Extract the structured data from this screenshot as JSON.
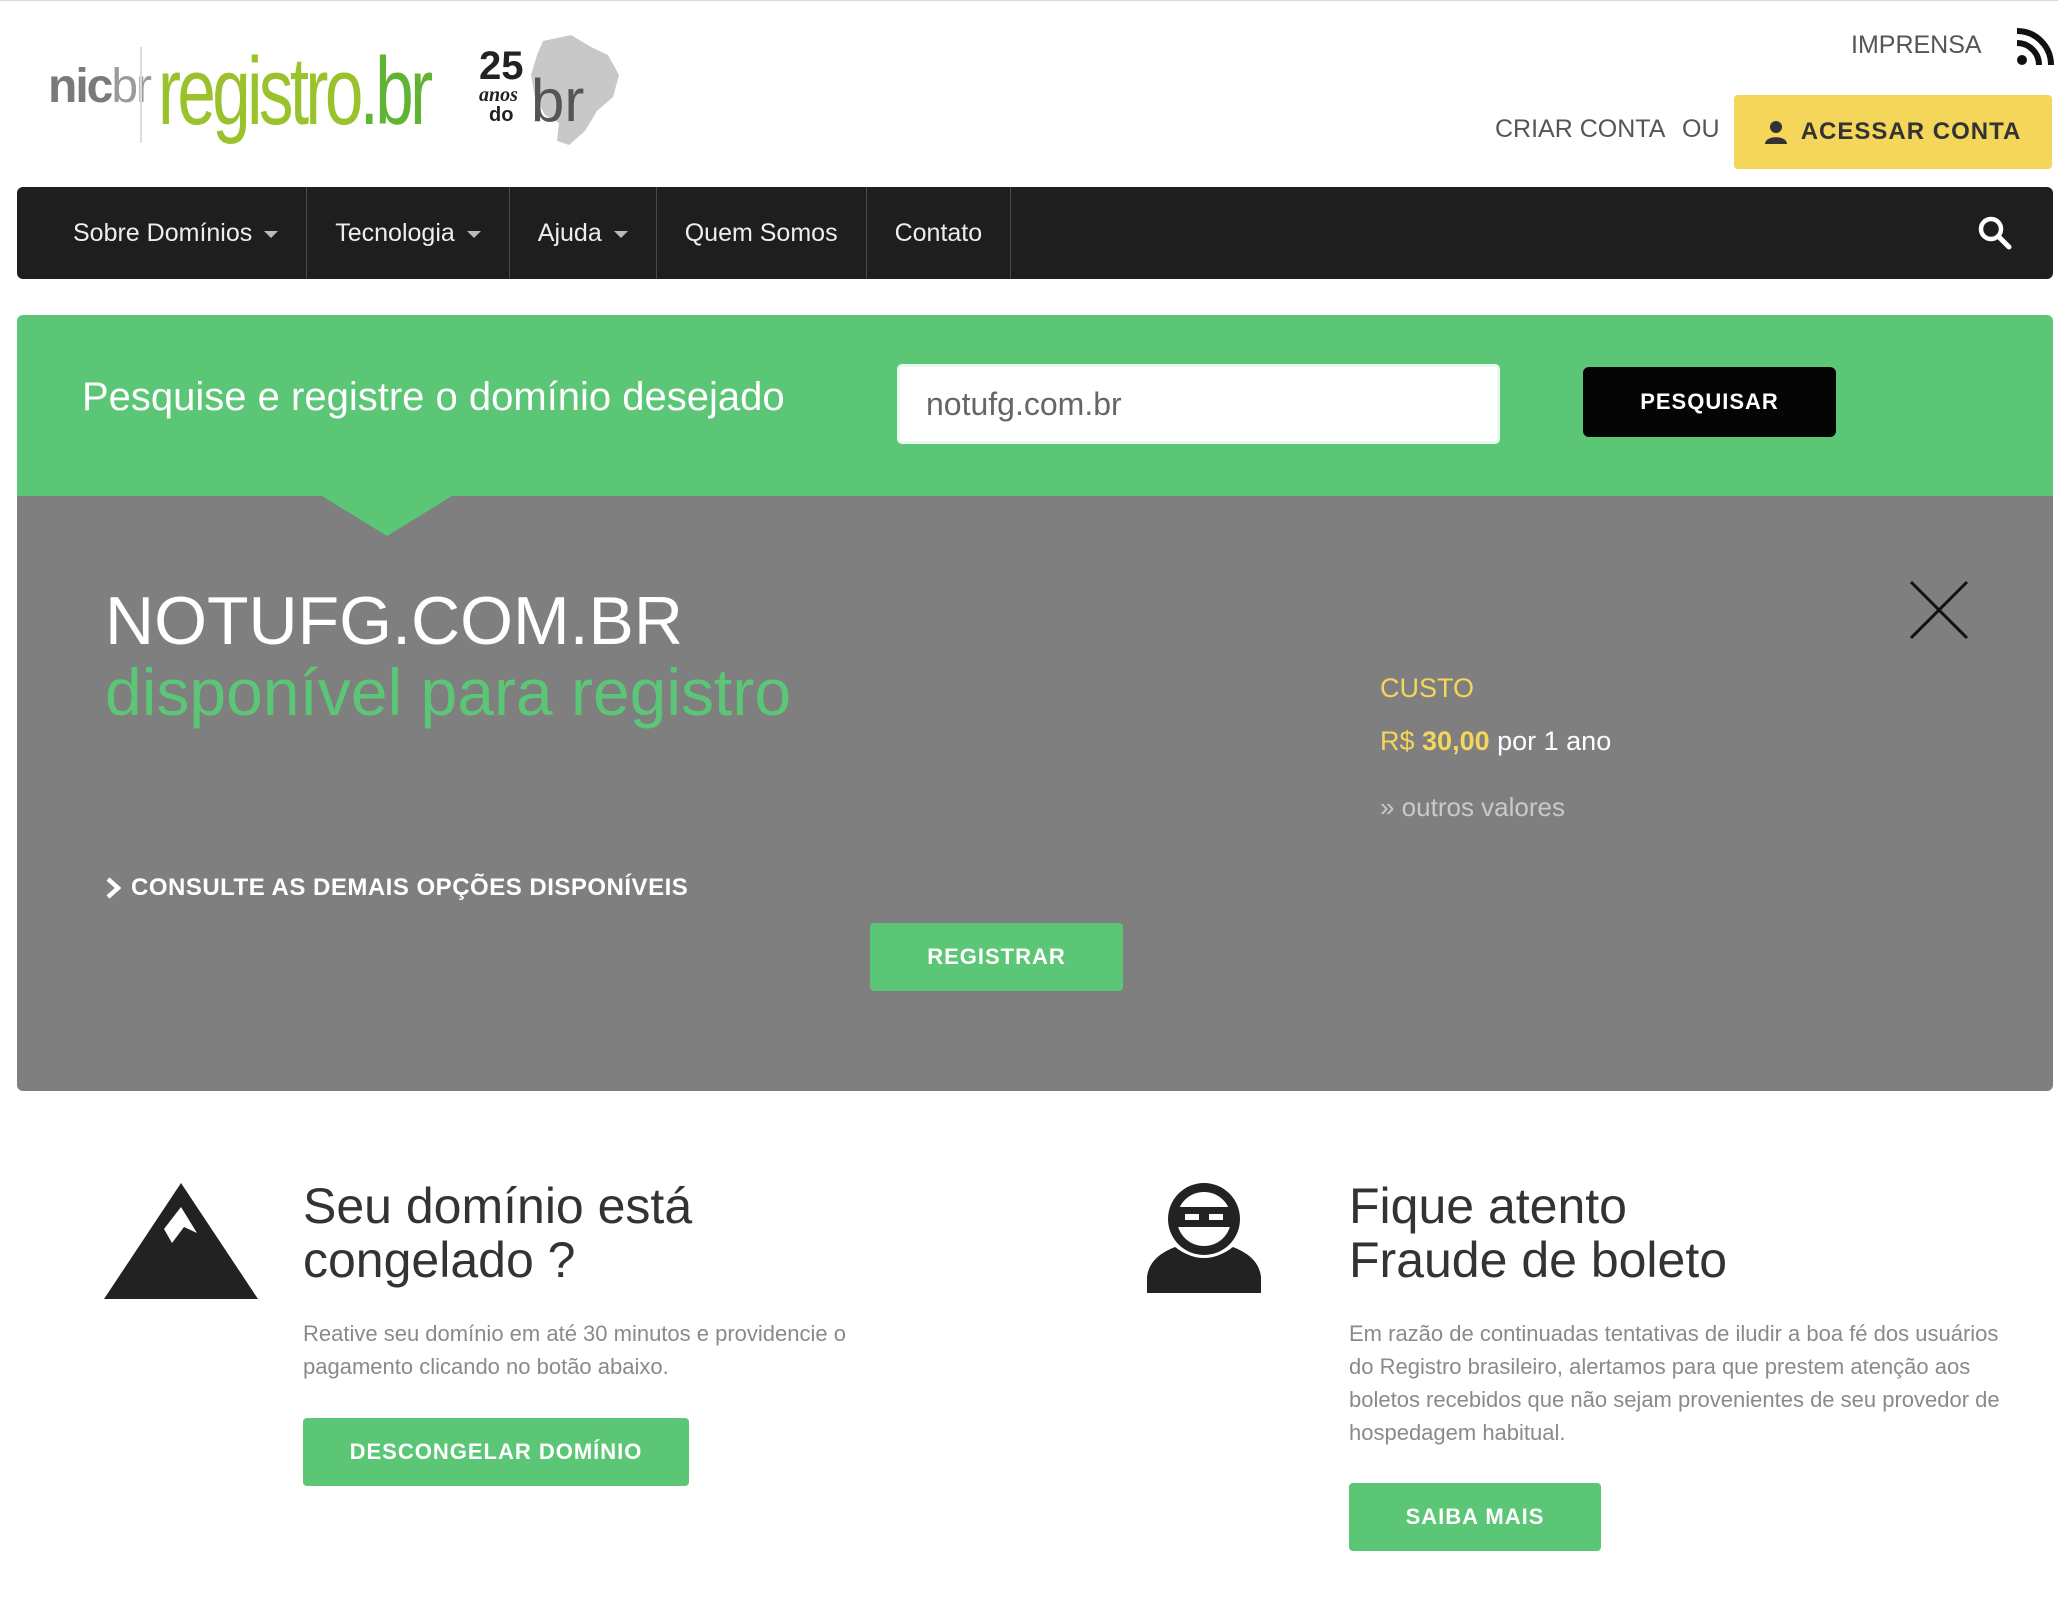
{
  "header": {
    "logo_nic": "nic",
    "logo_nic_suffix": "br",
    "logo_registro": "registro",
    "logo_registro_suffix": ".br",
    "logo_25_number": "25",
    "logo_25_anos": "anos",
    "logo_25_do": "do",
    "logo_25_br": "br",
    "imprensa": "IMPRENSA",
    "criar_conta": "CRIAR CONTA",
    "ou": "OU",
    "acessar_conta": "ACESSAR CONTA"
  },
  "nav": {
    "items": [
      {
        "label": "Sobre Domínios"
      },
      {
        "label": "Tecnologia"
      },
      {
        "label": "Ajuda"
      },
      {
        "label": "Quem Somos"
      },
      {
        "label": "Contato"
      }
    ]
  },
  "search": {
    "label": "Pesquise e registre o domínio desejado",
    "value": "notufg.com.br",
    "button": "PESQUISAR"
  },
  "result": {
    "domain": "NOTUFG.COM.BR",
    "status": "disponível para registro",
    "custo_label": "CUSTO",
    "price_currency": "R$",
    "price_value": "30,00",
    "price_period": "por 1 ano",
    "outros_valores": "» outros valores",
    "consulte": "CONSULTE AS DEMAIS OPÇÕES DISPONÍVEIS",
    "registrar": "REGISTRAR"
  },
  "cards": {
    "congelado": {
      "title_line1": "Seu domínio está",
      "title_line2": "congelado ?",
      "body": "Reative seu domínio em até 30 minutos e providencie o pagamento clicando no botão abaixo.",
      "button": "DESCONGELAR DOMÍNIO"
    },
    "fraude": {
      "title_line1": "Fique atento",
      "title_line2": "Fraude de boleto",
      "body": "Em razão de continuadas tentativas de iludir a boa fé dos usuários do Registro brasileiro, alertamos para que prestem atenção aos boletos recebidos que não sejam provenientes de seu provedor de hospedagem habitual.",
      "button": "SAIBA MAIS"
    }
  },
  "colors": {
    "brand_green": "#5bc776",
    "accent_yellow": "#f3d65a",
    "navbar_bg": "#1e1e1e",
    "result_bg": "#7f7f7f"
  }
}
